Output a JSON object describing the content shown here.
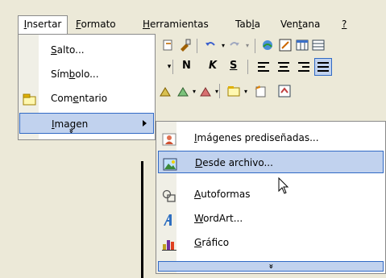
{
  "menubar": {
    "items": [
      {
        "label": "Insertar",
        "u": "I",
        "rest": "nsertar"
      },
      {
        "label": "Formato",
        "u": "F",
        "rest": "ormato"
      },
      {
        "label": "Herramientas",
        "u": "H",
        "rest": "erramientas"
      },
      {
        "label": "Tabla",
        "pre": "Tab",
        "u": "l",
        "rest": "a"
      },
      {
        "label": "Ventana",
        "pre": "Ven",
        "u": "t",
        "rest": "ana"
      },
      {
        "label": "?",
        "u": "?",
        "rest": ""
      }
    ]
  },
  "toolbar": {
    "bold": "N",
    "italic": "K",
    "underline": "S"
  },
  "insert_menu": {
    "items": [
      {
        "pre": "",
        "u": "S",
        "rest": "alto...",
        "icon": "none"
      },
      {
        "pre": "Sím",
        "u": "b",
        "rest": "olo...",
        "icon": "none"
      },
      {
        "pre": "Com",
        "u": "e",
        "rest": "ntario",
        "icon": "comment-icon"
      },
      {
        "pre": "",
        "u": "I",
        "rest": "magen",
        "icon": "none"
      }
    ],
    "expand": "»"
  },
  "imagen_submenu": {
    "items": [
      {
        "pre": "",
        "u": "I",
        "rest": "mágenes prediseñadas...",
        "icon": "clipart-icon"
      },
      {
        "pre": "",
        "u": "D",
        "rest": "esde archivo...",
        "icon": "picture-from-file-icon"
      },
      {
        "pre": "",
        "u": "A",
        "rest": "utoformas",
        "icon": "autoshapes-icon"
      },
      {
        "pre": "",
        "u": "W",
        "rest": "ordArt...",
        "icon": "wordart-icon"
      },
      {
        "pre": "",
        "u": "G",
        "rest": "ráfico",
        "icon": "chart-icon"
      }
    ],
    "expand": "»"
  },
  "colors": {
    "highlight": "#c1d2ee",
    "highlight_border": "#316ac5",
    "menu_bg": "#ffffff",
    "gutter": "#f0efe6"
  }
}
